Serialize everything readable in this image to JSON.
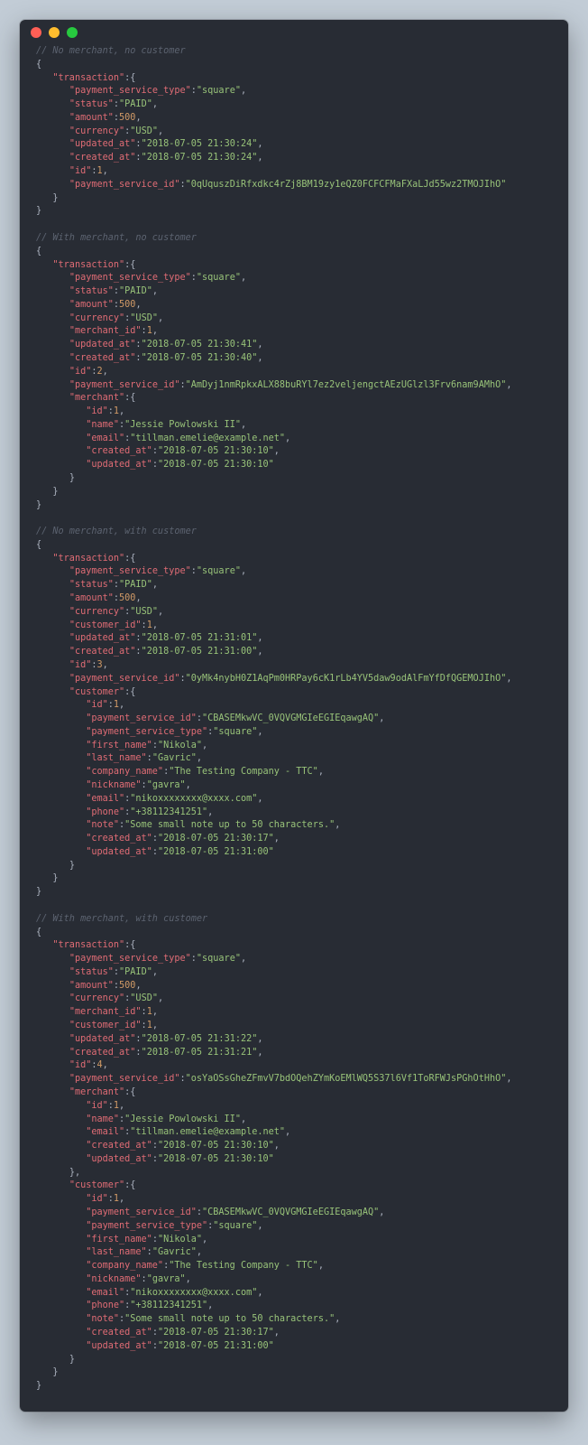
{
  "blocks": [
    {
      "comment": "No merchant, no customer",
      "json": {
        "transaction": {
          "payment_service_type": "square",
          "status": "PAID",
          "amount": 500,
          "currency": "USD",
          "updated_at": "2018-07-05 21:30:24",
          "created_at": "2018-07-05 21:30:24",
          "id": 1,
          "payment_service_id": "0qUquszDiRfxdkc4rZj8BM19zy1eQZ0FCFCFMaFXaLJd55wz2TMOJIhO"
        }
      }
    },
    {
      "comment": "With merchant, no customer",
      "json": {
        "transaction": {
          "payment_service_type": "square",
          "status": "PAID",
          "amount": 500,
          "currency": "USD",
          "merchant_id": 1,
          "updated_at": "2018-07-05 21:30:41",
          "created_at": "2018-07-05 21:30:40",
          "id": 2,
          "payment_service_id": "AmDyj1nmRpkxALX88buRYl7ez2veljengctAEzUGlzl3Frv6nam9AMhO",
          "merchant": {
            "id": 1,
            "name": "Jessie Powlowski II",
            "email": "tillman.emelie@example.net",
            "created_at": "2018-07-05 21:30:10",
            "updated_at": "2018-07-05 21:30:10"
          }
        }
      }
    },
    {
      "comment": "No merchant, with customer",
      "json": {
        "transaction": {
          "payment_service_type": "square",
          "status": "PAID",
          "amount": 500,
          "currency": "USD",
          "customer_id": 1,
          "updated_at": "2018-07-05 21:31:01",
          "created_at": "2018-07-05 21:31:00",
          "id": 3,
          "payment_service_id": "0yMk4nybH0Z1AqPm0HRPay6cK1rLb4YV5daw9odAlFmYfDfQGEMOJIhO",
          "customer": {
            "id": 1,
            "payment_service_id": "CBASEMkwVC_0VQVGMGIeEGIEqawgAQ",
            "payment_service_type": "square",
            "first_name": "Nikola",
            "last_name": "Gavric",
            "company_name": "The Testing Company - TTC",
            "nickname": "gavra",
            "email": "nikoxxxxxxxx@xxxx.com",
            "phone": "+38112341251",
            "note": "Some small note up to 50 characters.",
            "created_at": "2018-07-05 21:30:17",
            "updated_at": "2018-07-05 21:31:00"
          }
        }
      }
    },
    {
      "comment": "With merchant, with customer",
      "json": {
        "transaction": {
          "payment_service_type": "square",
          "status": "PAID",
          "amount": 500,
          "currency": "USD",
          "merchant_id": 1,
          "customer_id": 1,
          "updated_at": "2018-07-05 21:31:22",
          "created_at": "2018-07-05 21:31:21",
          "id": 4,
          "payment_service_id": "osYaOSsGheZFmvV7bdOQehZYmKoEMlWQ5S37l6Vf1ToRFWJsPGhOtHhO",
          "merchant": {
            "id": 1,
            "name": "Jessie Powlowski II",
            "email": "tillman.emelie@example.net",
            "created_at": "2018-07-05 21:30:10",
            "updated_at": "2018-07-05 21:30:10"
          },
          "customer": {
            "id": 1,
            "payment_service_id": "CBASEMkwVC_0VQVGMGIeEGIEqawgAQ",
            "payment_service_type": "square",
            "first_name": "Nikola",
            "last_name": "Gavric",
            "company_name": "The Testing Company - TTC",
            "nickname": "gavra",
            "email": "nikoxxxxxxxx@xxxx.com",
            "phone": "+38112341251",
            "note": "Some small note up to 50 characters.",
            "created_at": "2018-07-05 21:30:17",
            "updated_at": "2018-07-05 21:31:00"
          }
        }
      }
    }
  ]
}
